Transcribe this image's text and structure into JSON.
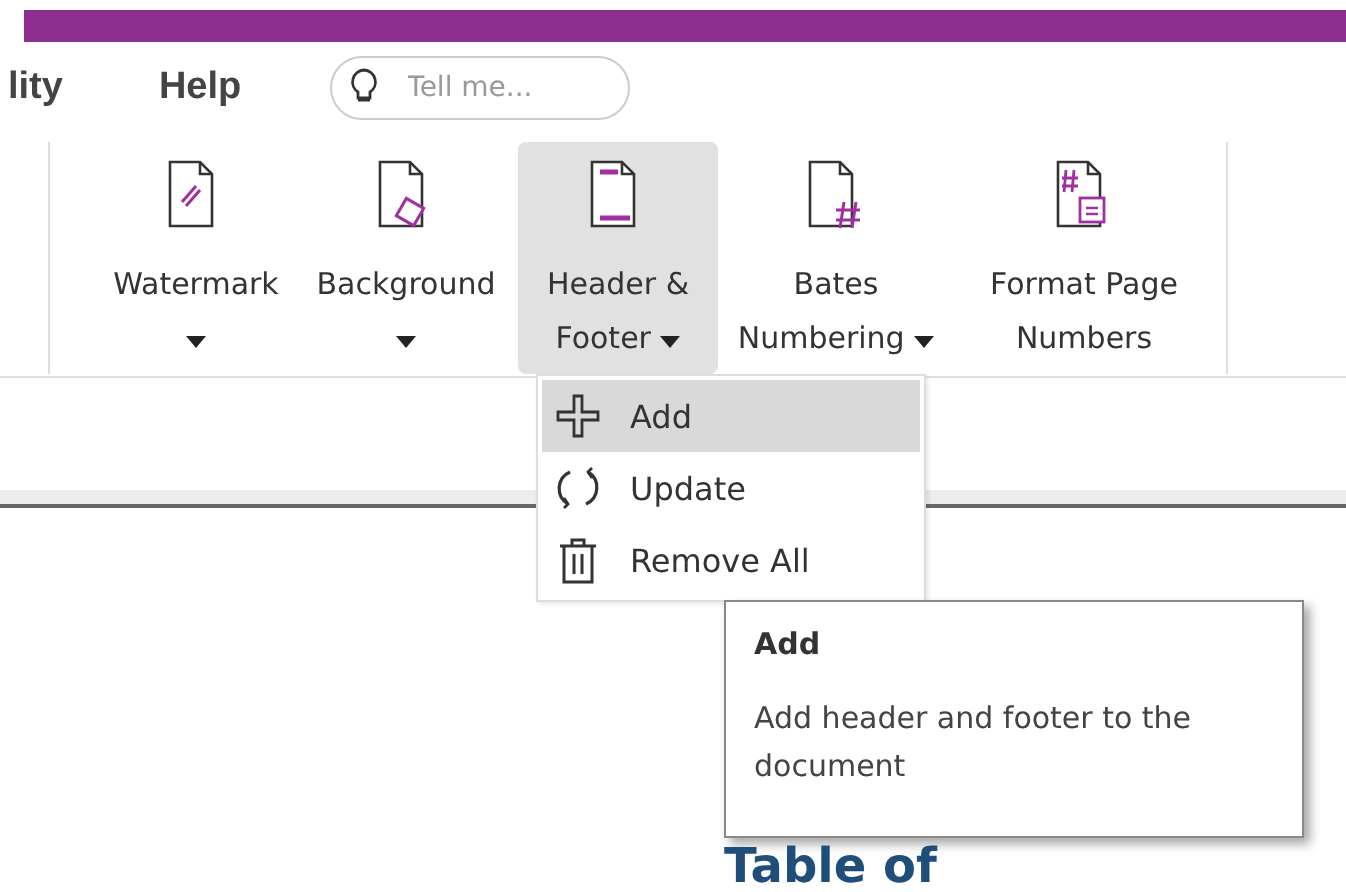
{
  "menu_tabs": [
    {
      "label": "lity"
    },
    {
      "label": "Help"
    }
  ],
  "search": {
    "placeholder": "Tell me..."
  },
  "ribbon_buttons": [
    {
      "kind": "watermark",
      "label": "Watermark",
      "has_dropdown": true,
      "selected": false
    },
    {
      "kind": "background",
      "label": "Background",
      "has_dropdown": true,
      "selected": false
    },
    {
      "kind": "header_footer",
      "label": "Header & Footer",
      "has_dropdown": true,
      "selected": true
    },
    {
      "kind": "bates",
      "label": "Bates Numbering",
      "has_dropdown": true,
      "selected": false
    },
    {
      "kind": "format_numbers",
      "label": "Format Page Numbers",
      "has_dropdown": false,
      "selected": false
    }
  ],
  "dropdown_menu": [
    {
      "kind": "add",
      "label": "Add",
      "selected": true
    },
    {
      "kind": "update",
      "label": "Update",
      "selected": false
    },
    {
      "kind": "remove",
      "label": "Remove All",
      "selected": false
    }
  ],
  "tooltip": {
    "title": "Add",
    "description": "Add header and footer to the document"
  },
  "document": {
    "heading": "Table of"
  }
}
